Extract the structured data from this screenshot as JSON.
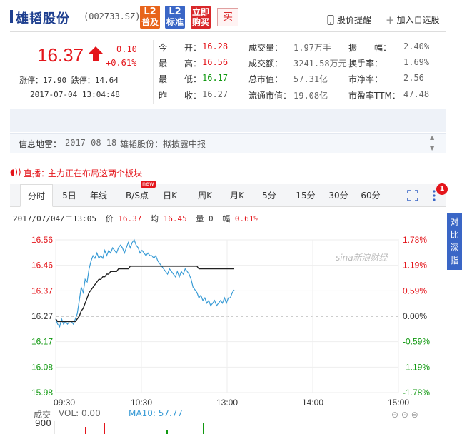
{
  "header": {
    "name": "雄韬股份",
    "code": "(002733.SZ)",
    "l2_basic_top": "L2",
    "l2_basic_bottom": "普及",
    "l2_std_top": "L2",
    "l2_std_bottom": "标准",
    "l2_buy_top": "立即",
    "l2_buy_bottom": "购买",
    "buy_label": "买",
    "alert_label": "股价提醒",
    "watch_label": "加入自选股"
  },
  "quote": {
    "price": "16.37",
    "change": "0.10",
    "change_pct": "+0.61%",
    "limits": "涨停：17.90  跌停：14.64",
    "timestamp": "2017-07-04  13:04:48",
    "col1": [
      {
        "label": "今　　开：",
        "value": "16.28",
        "color": "red"
      },
      {
        "label": "最　　高：",
        "value": "16.56",
        "color": "red"
      },
      {
        "label": "最　　低：",
        "value": "16.17",
        "color": "green"
      },
      {
        "label": "昨　　收：",
        "value": "16.27",
        "color": "grey"
      }
    ],
    "col2": [
      {
        "label": "成交量：",
        "value": "1.97万手"
      },
      {
        "label": "成交额：",
        "value": "3241.58万元"
      },
      {
        "label": "总市值：",
        "value": "57.31亿"
      },
      {
        "label": "流通市值：",
        "value": "19.08亿"
      }
    ],
    "col3": [
      {
        "label": "振　　幅：",
        "value": "2.40%"
      },
      {
        "label": "换手率：",
        "value": "1.69%"
      },
      {
        "label": "市净率：",
        "value": "2.56"
      },
      {
        "label": "市盈率TTM：",
        "value": "47.48"
      }
    ]
  },
  "news": {
    "label": "信息地雷：",
    "date": "2017-08-18",
    "text": "雄韬股份：拟披露中报",
    "up_icon": "triangle-up",
    "down_icon": "triangle-down"
  },
  "live": {
    "label": "直播：",
    "text": "主力正在布局这两个板块"
  },
  "tabs": [
    {
      "label": "分时",
      "active": true
    },
    {
      "label": "5日"
    },
    {
      "label": "年线"
    },
    {
      "label": "B/S点"
    },
    {
      "label": "日K"
    },
    {
      "label": "周K"
    },
    {
      "label": "月K"
    },
    {
      "label": "5分"
    },
    {
      "label": "15分"
    },
    {
      "label": "30分"
    },
    {
      "label": "60分"
    }
  ],
  "new_badge": "new",
  "notify_count": "1",
  "info_line": {
    "datetime": "2017/07/04/二13:05",
    "price_label": "价",
    "price": "16.37",
    "avg_label": "均",
    "avg": "16.45",
    "vol_label": "量",
    "vol": "0",
    "amp_label": "幅",
    "amp": "0.61%"
  },
  "side_tab": "对比深指",
  "watermark": "sina新浪财经",
  "chart_data": {
    "type": "line",
    "x_ticks": [
      "09:30",
      "10:30",
      "13:00",
      "14:00",
      "15:00"
    ],
    "y_left_ticks": [
      "16.56",
      "16.46",
      "16.37",
      "16.27",
      "16.17",
      "16.08",
      "15.98"
    ],
    "y_right_ticks": [
      "1.78%",
      "1.19%",
      "0.59%",
      "0.00%",
      "-0.59%",
      "-1.19%",
      "-1.78%"
    ],
    "ylim": [
      15.98,
      16.56
    ],
    "prev_close": 16.27,
    "series": [
      {
        "name": "价",
        "color": "#3a9cd6",
        "values": [
          16.26,
          16.24,
          16.23,
          16.26,
          16.24,
          16.25,
          16.24,
          16.25,
          16.25,
          16.24,
          16.26,
          16.28,
          16.33,
          16.38,
          16.36,
          16.41,
          16.4,
          16.45,
          16.48,
          16.5,
          16.49,
          16.51,
          16.49,
          16.5,
          16.49,
          16.52,
          16.5,
          16.52,
          16.51,
          16.53,
          16.52,
          16.51,
          16.53,
          16.54,
          16.53,
          16.51,
          16.53,
          16.55,
          16.53,
          16.55,
          16.56,
          16.54,
          16.53,
          16.51,
          16.52,
          16.51,
          16.5,
          16.51,
          16.5,
          16.5,
          16.49,
          16.5,
          16.48,
          16.47,
          16.46,
          16.45,
          16.44,
          16.43,
          16.45,
          16.44,
          16.43,
          16.42,
          16.44,
          16.42,
          16.44,
          16.43,
          16.45,
          16.44,
          16.43,
          16.41,
          16.38,
          16.37,
          16.36,
          16.34,
          16.35,
          16.33,
          16.34,
          16.32,
          16.33,
          16.31,
          16.32,
          16.33,
          16.31,
          16.32,
          16.33,
          16.32,
          16.34,
          16.32,
          16.34,
          16.34,
          16.36,
          16.37
        ]
      },
      {
        "name": "均",
        "color": "#222222",
        "values": [
          16.26,
          16.25,
          16.25,
          16.25,
          16.25,
          16.25,
          16.25,
          16.25,
          16.25,
          16.25,
          16.25,
          16.26,
          16.27,
          16.29,
          16.3,
          16.32,
          16.34,
          16.36,
          16.37,
          16.38,
          16.39,
          16.4,
          16.41,
          16.41,
          16.42,
          16.42,
          16.43,
          16.43,
          16.44,
          16.44,
          16.44,
          16.44,
          16.45,
          16.45,
          16.45,
          16.45,
          16.45,
          16.45,
          16.46,
          16.46,
          16.46,
          16.46,
          16.46,
          16.46,
          16.46,
          16.46,
          16.46,
          16.46,
          16.46,
          16.46,
          16.46,
          16.46,
          16.46,
          16.46,
          16.46,
          16.46,
          16.46,
          16.46,
          16.46,
          16.46,
          16.46,
          16.46,
          16.46,
          16.46,
          16.46,
          16.46,
          16.46,
          16.46,
          16.46,
          16.46,
          16.46,
          16.46,
          16.46,
          16.45,
          16.45,
          16.45,
          16.45,
          16.45,
          16.45,
          16.45,
          16.45,
          16.45,
          16.45,
          16.45,
          16.45,
          16.45,
          16.45,
          16.45,
          16.45,
          16.45,
          16.45,
          16.45
        ]
      }
    ],
    "volume_label": "成交",
    "volume_value": "VOL: 0.00",
    "ma_value": "MA10: 57.77",
    "volume_axis_top": "900"
  }
}
